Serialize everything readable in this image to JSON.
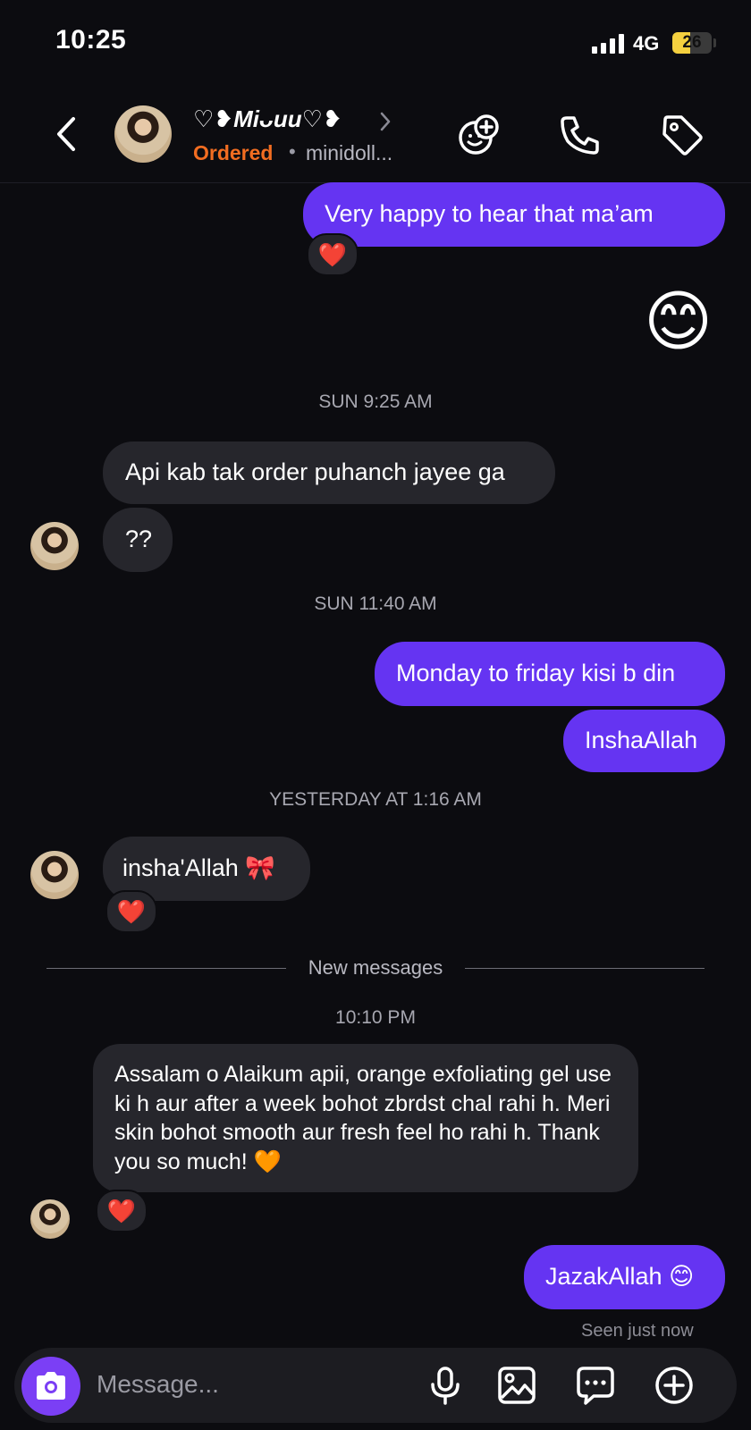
{
  "status_bar": {
    "time": "10:25",
    "network": "4G",
    "battery": "26"
  },
  "header": {
    "contact_name": "♡❥Miᴗuu♡❥",
    "order_status": "Ordered",
    "separator": "•",
    "shop_name": "minidoll..."
  },
  "chat": {
    "msg1": "Very happy to hear that ma’am",
    "msg1_reaction": "❤️",
    "emoji_msg": "😊",
    "ts1": "SUN 9:25 AM",
    "msg2": "Api kab tak order puhanch jayee ga",
    "msg3": "??",
    "ts2": "SUN 11:40 AM",
    "msg4": "Monday to friday kisi b din",
    "msg5": "InshaAllah",
    "ts3": "YESTERDAY AT 1:16 AM",
    "msg6": "insha'Allah 🎀",
    "msg6_reaction": "❤️",
    "new_messages": "New messages",
    "ts4": "10:10 PM",
    "msg7": "Assalam o Alaikum apii, orange exfoliating gel use ki h aur after a week bohot zbrdst chal rahi h. Meri skin bohot smooth aur fresh feel ho rahi h. Thank you so much! 🧡",
    "msg7_reaction": "❤️",
    "msg8": "JazakAllah 😊",
    "seen": "Seen just now"
  },
  "composer": {
    "placeholder": "Message..."
  },
  "icons": [
    "back-icon",
    "chevron-right-icon",
    "add-friend-icon",
    "phone-icon",
    "tag-icon",
    "camera-icon",
    "microphone-icon",
    "image-icon",
    "chat-bubble-icon",
    "plus-circle-icon"
  ],
  "colors": {
    "background": "#0c0c10",
    "sent_bubble": "#6534f2",
    "received_bubble": "#26262c",
    "ordered": "#f26d21",
    "camera_button": "#7b3ff5"
  }
}
